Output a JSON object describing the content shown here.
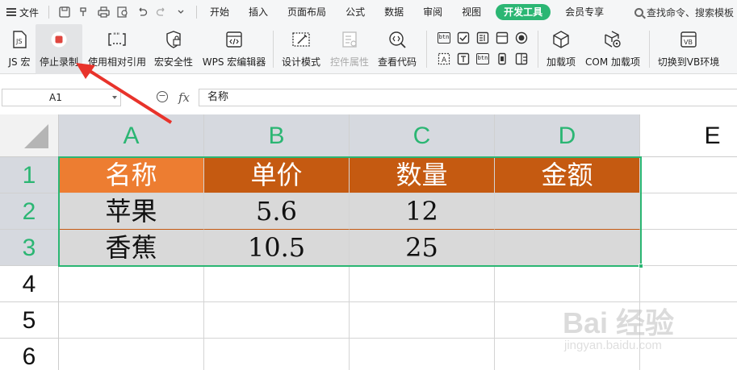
{
  "menubar": {
    "file_label": "文件",
    "tabs": [
      "开始",
      "插入",
      "页面布局",
      "公式",
      "数据",
      "审阅",
      "视图",
      "开发工具",
      "会员专享"
    ],
    "active_tab": "开发工具",
    "search_placeholder": "查找命令、搜索模板"
  },
  "ribbon": {
    "buttons": {
      "js_macro": "JS 宏",
      "stop_record": "停止录制",
      "relative_ref": "使用相对引用",
      "macro_security": "宏安全性",
      "wps_macro_editor": "WPS 宏编辑器",
      "design_mode": "设计模式",
      "control_props": "控件属性",
      "view_code": "查看代码",
      "addins": "加载项",
      "com_addins": "COM 加载项",
      "switch_vb": "切换到VB环境"
    },
    "control_labels": [
      "btn",
      "btn"
    ]
  },
  "formula_bar": {
    "cell_ref": "A1",
    "fx_label": "fx",
    "content": "名称"
  },
  "sheet": {
    "columns": [
      "A",
      "B",
      "C",
      "D",
      "E"
    ],
    "rows": [
      "1",
      "2",
      "3",
      "4",
      "5",
      "6"
    ],
    "table": {
      "header": [
        "名称",
        "单价",
        "数量",
        "金额"
      ],
      "rows": [
        [
          "苹果",
          "5.6",
          "12",
          ""
        ],
        [
          "香蕉",
          "10.5",
          "25",
          ""
        ]
      ]
    },
    "colors": {
      "header_first": "#ed7d31",
      "header_rest": "#c55a11",
      "body_fill": "#d9d9d9",
      "selection": "#2bb673"
    }
  },
  "watermark": {
    "brand": "Bai 经验",
    "url": "jingyan.baidu.com"
  }
}
